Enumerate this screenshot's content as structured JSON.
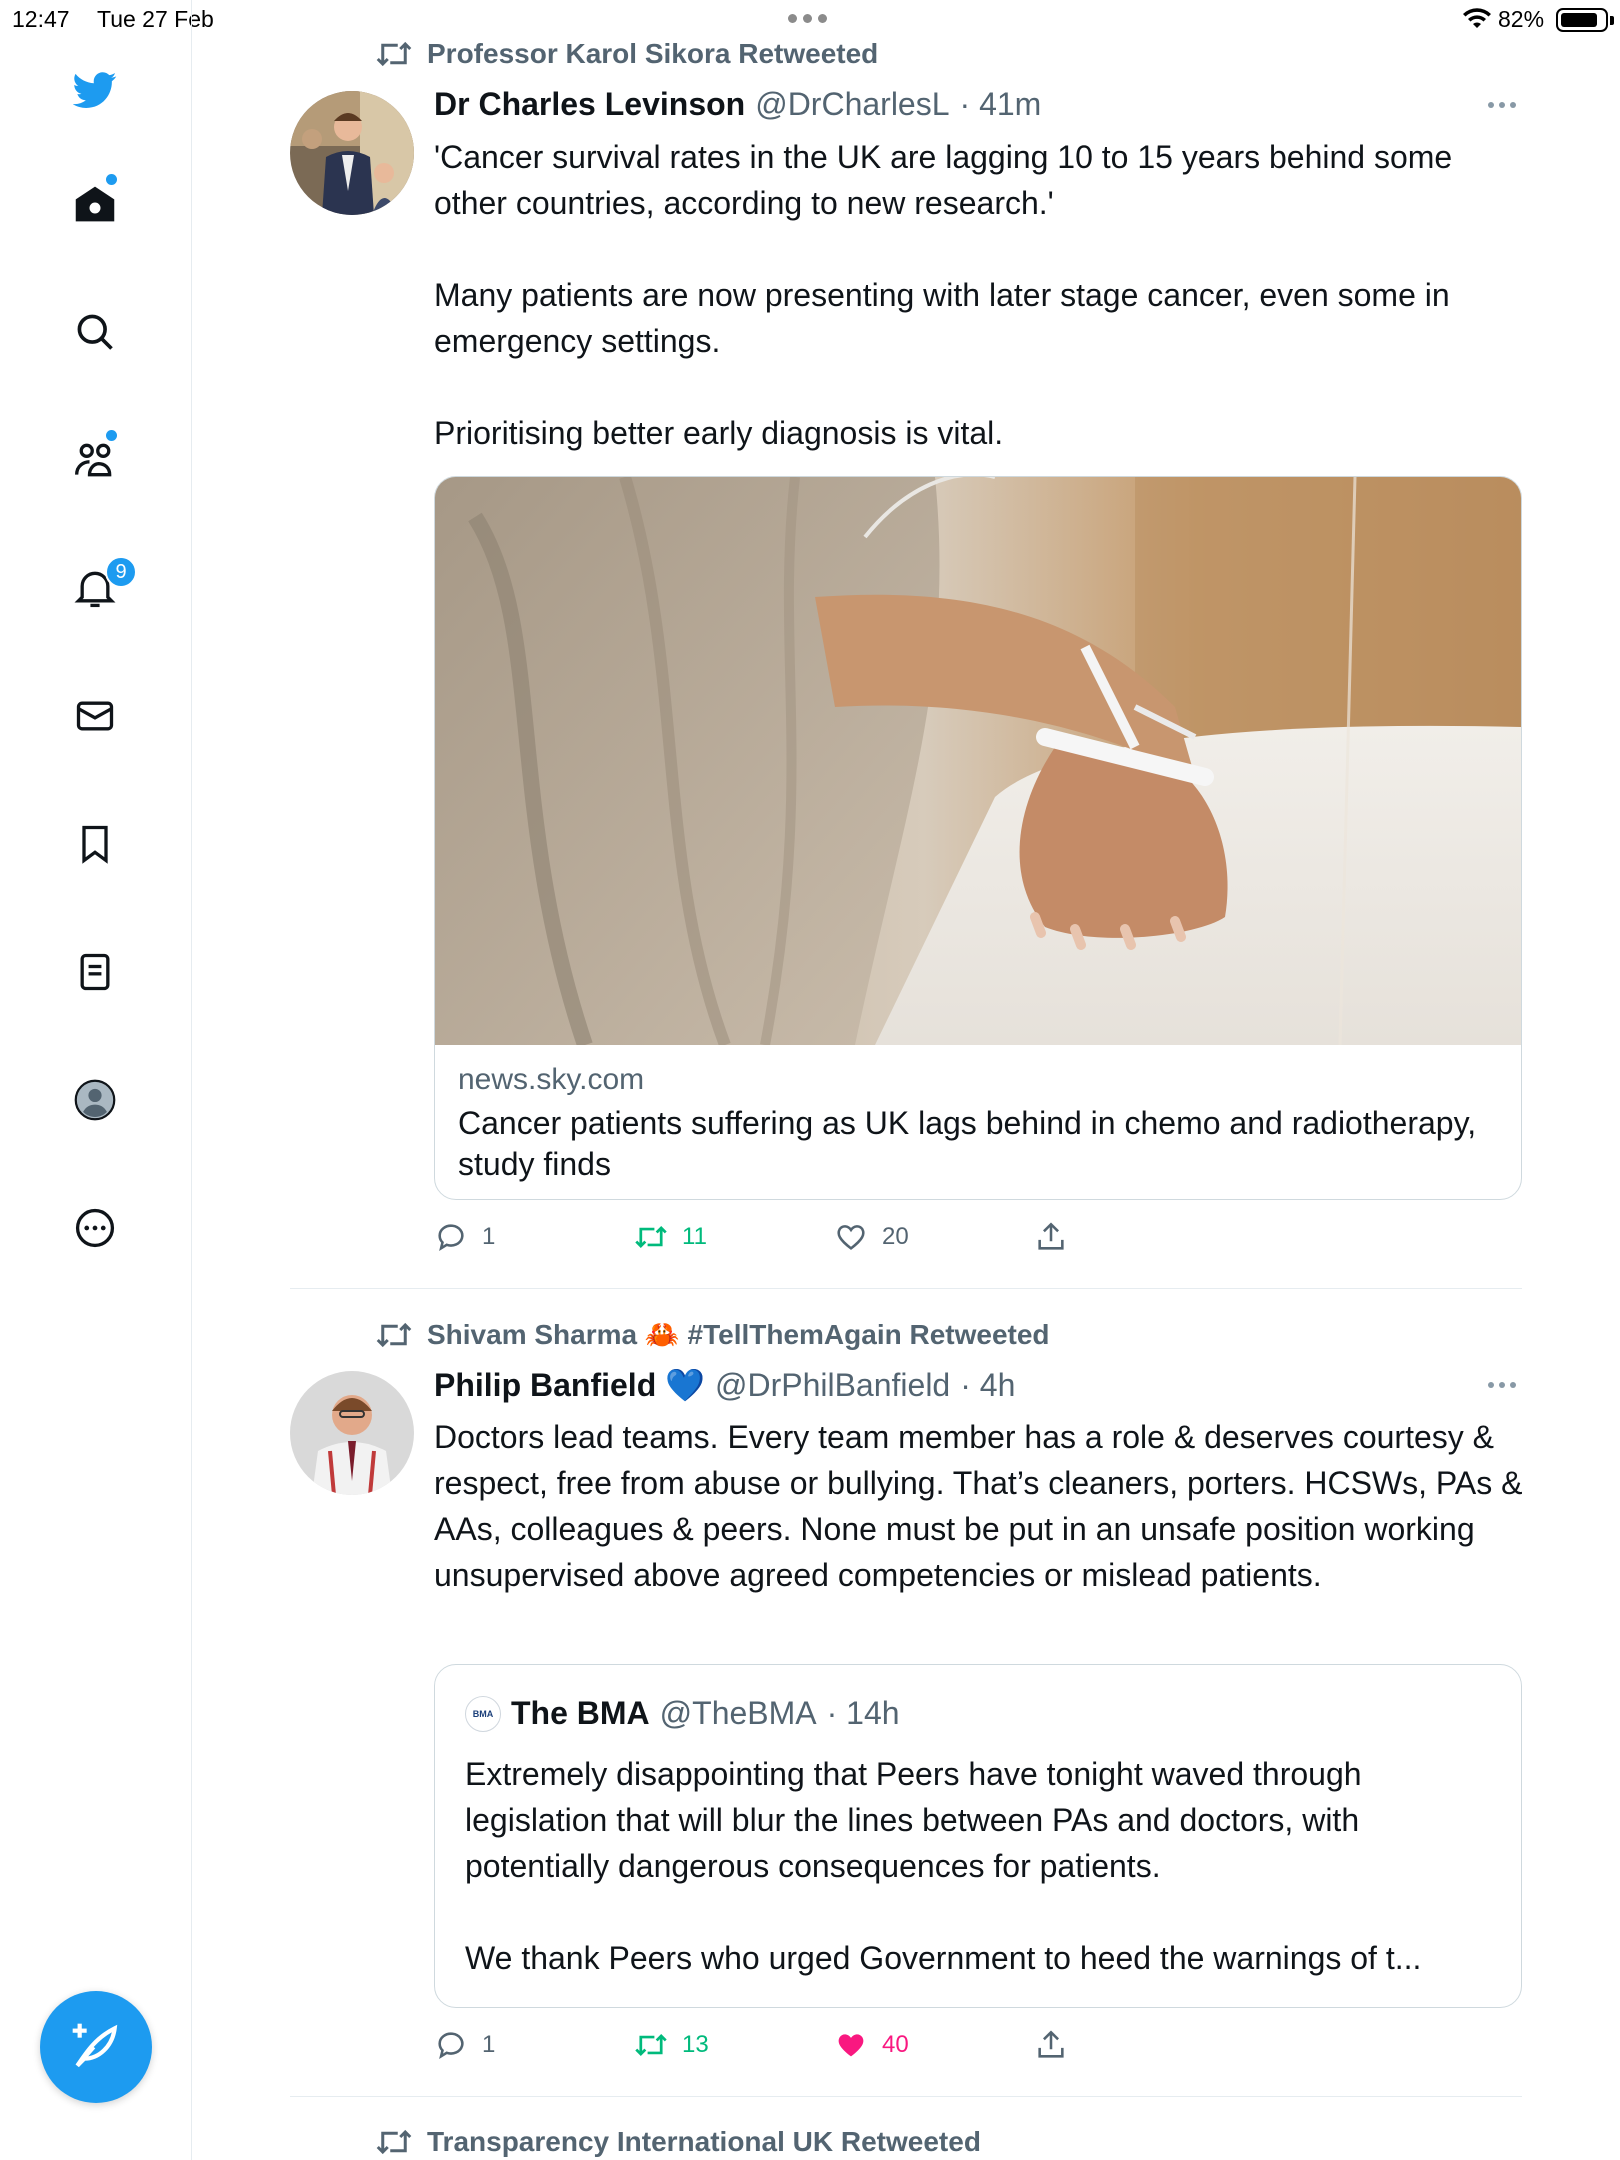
{
  "status_bar": {
    "time": "12:47",
    "date": "Tue 27 Feb",
    "battery": "82%"
  },
  "sidebar": {
    "items": [
      {
        "icon": "twitter-bird-icon"
      },
      {
        "icon": "home-icon",
        "has_dot": true
      },
      {
        "icon": "search-icon"
      },
      {
        "icon": "communities-icon",
        "has_dot": true
      },
      {
        "icon": "bell-icon",
        "badge": "9"
      },
      {
        "icon": "mail-icon"
      },
      {
        "icon": "bookmark-icon"
      },
      {
        "icon": "lists-icon"
      },
      {
        "icon": "profile-icon"
      },
      {
        "icon": "more-circle-icon"
      }
    ],
    "compose_icon": "compose-feather-icon",
    "accent": "#1d9bf0"
  },
  "tweets": [
    {
      "retweeted_by": "Professor Karol Sikora Retweeted",
      "name": "Dr Charles Levinson",
      "handle": "@DrCharlesL",
      "time": "· 41m",
      "text": "'Cancer survival rates in the UK are lagging 10 to 15 years behind some other countries, according to new research.'\n\nMany patients are now presenting with later stage cancer, even some in emergency settings.\n\nPrioritising better early diagnosis is vital.",
      "card": {
        "domain": "news.sky.com",
        "title": "Cancer patients suffering as UK lags behind in chemo and radiotherapy, study finds"
      },
      "replies": "1",
      "retweets": "11",
      "likes": "20",
      "retweeted": true,
      "liked": false
    },
    {
      "retweeted_by": "Shivam Sharma 🦀 #TellThemAgain Retweeted",
      "name": "Philip Banfield 💙",
      "handle": "@DrPhilBanfield",
      "time": "· 4h",
      "text": "Doctors lead teams. Every team member has a role & deserves courtesy & respect, free from abuse or bullying. That’s cleaners, porters. HCSWs, PAs & AAs, colleagues & peers. None must be put in an unsafe position working unsupervised above agreed competencies or mislead patients.",
      "quote": {
        "logo": "BMA",
        "name": "The BMA",
        "handle": "@TheBMA",
        "time": "· 14h",
        "text": "Extremely disappointing that Peers have tonight waved through legislation that will blur the lines between PAs and doctors, with potentially dangerous consequences for patients.\n\nWe thank Peers who urged Government to heed the warnings of t..."
      },
      "replies": "1",
      "retweets": "13",
      "likes": "40",
      "retweeted": true,
      "liked": true
    }
  ],
  "next_retweeted_by": "Transparency International UK Retweeted",
  "colors": {
    "retweet_green": "#00ba7c",
    "like_pink": "#f91880",
    "secondary_text": "#536471"
  }
}
